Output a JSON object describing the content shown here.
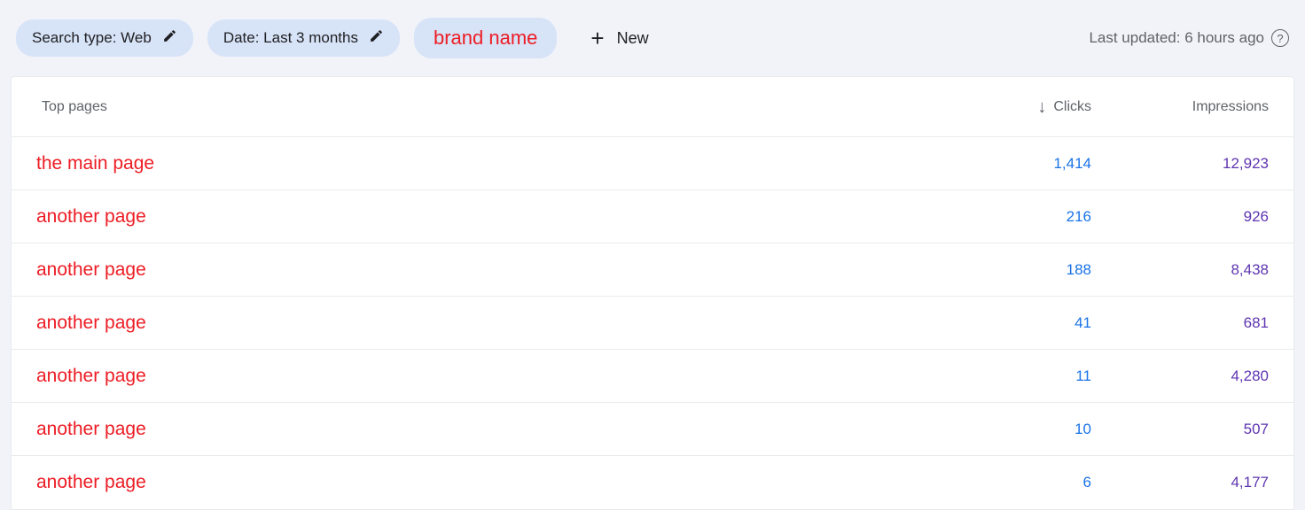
{
  "filters": {
    "search_type": "Search type: Web",
    "date": "Date: Last 3 months",
    "brand": "brand name",
    "new_label": "New"
  },
  "last_updated": "Last updated: 6 hours ago",
  "table": {
    "header_page": "Top pages",
    "header_clicks": "Clicks",
    "header_impressions": "Impressions",
    "rows": [
      {
        "page": "the main page",
        "clicks": "1,414",
        "impressions": "12,923"
      },
      {
        "page": "another page",
        "clicks": "216",
        "impressions": "926"
      },
      {
        "page": "another page",
        "clicks": "188",
        "impressions": "8,438"
      },
      {
        "page": "another page",
        "clicks": "41",
        "impressions": "681"
      },
      {
        "page": "another page",
        "clicks": "11",
        "impressions": "4,280"
      },
      {
        "page": "another page",
        "clicks": "10",
        "impressions": "507"
      },
      {
        "page": "another page",
        "clicks": "6",
        "impressions": "4,177"
      }
    ]
  }
}
